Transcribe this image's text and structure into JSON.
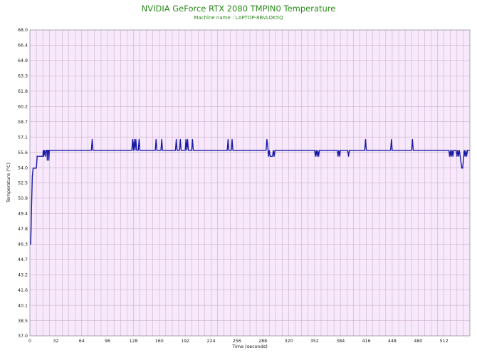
{
  "chart_data": {
    "type": "line",
    "title": "NVIDIA GeForce RTX 2080 TMPIN0 Temperature",
    "subtitle": "Machine name : LAPTOP-8BVLOK5Q",
    "xlabel": "Time (seconds)",
    "ylabel": "Temperature (°C)",
    "xlim": [
      0,
      544
    ],
    "ylim": [
      37.0,
      68.0
    ],
    "x_ticks": [
      "0",
      "32",
      "64",
      "96",
      "128",
      "160",
      "192",
      "224",
      "256",
      "288",
      "320",
      "352",
      "384",
      "416",
      "448",
      "480",
      "512"
    ],
    "y_ticks": [
      "37.0",
      "38.5",
      "40.1",
      "41.6",
      "43.2",
      "44.7",
      "46.3",
      "47.8",
      "49.4",
      "50.9",
      "52.5",
      "54.0",
      "55.6",
      "57.1",
      "58.7",
      "60.2",
      "61.8",
      "63.3",
      "64.9",
      "66.4",
      "68.0"
    ],
    "grid": true,
    "background_color": "#f7e9fb",
    "grid_color": "#c5a4c5",
    "line_color": "#1a1aa8",
    "title_color": "#2a8a1a",
    "series": [
      {
        "points": [
          [
            0,
            46.3
          ],
          [
            1,
            46.3
          ],
          [
            2,
            50.0
          ],
          [
            3,
            53.2
          ],
          [
            4,
            54.0
          ],
          [
            8,
            54.0
          ],
          [
            9,
            55.2
          ],
          [
            16,
            55.2
          ],
          [
            16.5,
            55.8
          ],
          [
            17,
            55.2
          ],
          [
            18,
            55.8
          ],
          [
            19,
            55.2
          ],
          [
            20,
            55.8
          ],
          [
            21,
            55.8
          ],
          [
            21.5,
            54.8
          ],
          [
            22,
            55.8
          ],
          [
            23,
            55.8
          ],
          [
            23.5,
            54.8
          ],
          [
            24,
            55.8
          ],
          [
            76,
            55.8
          ],
          [
            77,
            56.9
          ],
          [
            78,
            55.8
          ],
          [
            126,
            55.8
          ],
          [
            127,
            56.9
          ],
          [
            128,
            55.8
          ],
          [
            129,
            56.9
          ],
          [
            130,
            55.8
          ],
          [
            131,
            56.9
          ],
          [
            132,
            55.8
          ],
          [
            134,
            55.8
          ],
          [
            135,
            56.9
          ],
          [
            136,
            55.8
          ],
          [
            155,
            55.8
          ],
          [
            156,
            56.9
          ],
          [
            157,
            55.8
          ],
          [
            162,
            55.8
          ],
          [
            163,
            56.9
          ],
          [
            164,
            55.8
          ],
          [
            180,
            55.8
          ],
          [
            181,
            56.9
          ],
          [
            182,
            55.8
          ],
          [
            185,
            55.8
          ],
          [
            186,
            56.9
          ],
          [
            187,
            55.8
          ],
          [
            192,
            55.8
          ],
          [
            193,
            56.9
          ],
          [
            194,
            55.8
          ],
          [
            195,
            56.9
          ],
          [
            196,
            55.8
          ],
          [
            200,
            55.8
          ],
          [
            201,
            56.9
          ],
          [
            202,
            55.8
          ],
          [
            244,
            55.8
          ],
          [
            245,
            56.9
          ],
          [
            246,
            55.8
          ],
          [
            249,
            55.8
          ],
          [
            250,
            56.9
          ],
          [
            251,
            55.8
          ],
          [
            292,
            55.8
          ],
          [
            293,
            56.9
          ],
          [
            294,
            56.3
          ],
          [
            295,
            55.2
          ],
          [
            296,
            55.8
          ],
          [
            297,
            55.2
          ],
          [
            300,
            55.2
          ],
          [
            301,
            55.8
          ],
          [
            302,
            55.2
          ],
          [
            303,
            55.8
          ],
          [
            352,
            55.8
          ],
          [
            353,
            55.2
          ],
          [
            354,
            55.8
          ],
          [
            355,
            55.2
          ],
          [
            356,
            55.8
          ],
          [
            357,
            55.2
          ],
          [
            358,
            55.8
          ],
          [
            380,
            55.8
          ],
          [
            381,
            55.2
          ],
          [
            382,
            55.8
          ],
          [
            383,
            55.2
          ],
          [
            384,
            55.8
          ],
          [
            393,
            55.8
          ],
          [
            394,
            55.2
          ],
          [
            395,
            55.8
          ],
          [
            414,
            55.8
          ],
          [
            415,
            56.9
          ],
          [
            416,
            55.8
          ],
          [
            446,
            55.8
          ],
          [
            447,
            56.9
          ],
          [
            448,
            55.8
          ],
          [
            472,
            55.8
          ],
          [
            473,
            56.9
          ],
          [
            474,
            55.8
          ],
          [
            518,
            55.8
          ],
          [
            519,
            55.2
          ],
          [
            520,
            55.8
          ],
          [
            521,
            55.2
          ],
          [
            522,
            55.8
          ],
          [
            523,
            55.2
          ],
          [
            524,
            55.8
          ],
          [
            527,
            55.8
          ],
          [
            528,
            55.2
          ],
          [
            529,
            55.8
          ],
          [
            530,
            55.2
          ],
          [
            531,
            55.8
          ],
          [
            532,
            55.2
          ],
          [
            533,
            54.6
          ],
          [
            534,
            54.0
          ],
          [
            535,
            54.0
          ],
          [
            536,
            54.8
          ],
          [
            537,
            55.8
          ],
          [
            538,
            55.2
          ],
          [
            539,
            55.8
          ],
          [
            540,
            55.2
          ],
          [
            541,
            55.8
          ],
          [
            544,
            55.8
          ]
        ]
      }
    ]
  }
}
